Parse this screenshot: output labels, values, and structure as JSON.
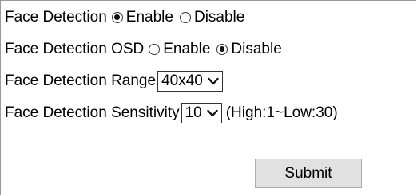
{
  "face_detection": {
    "label": "Face Detection",
    "options": [
      {
        "label": "Enable",
        "checked": true
      },
      {
        "label": "Disable",
        "checked": false
      }
    ]
  },
  "face_detection_osd": {
    "label": "Face Detection OSD",
    "options": [
      {
        "label": "Enable",
        "checked": false
      },
      {
        "label": "Disable",
        "checked": true
      }
    ]
  },
  "face_detection_range": {
    "label": "Face Detection Range",
    "selected": "40x40"
  },
  "face_detection_sensitivity": {
    "label": "Face Detection Sensitivity",
    "selected": "10",
    "hint": "(High:1~Low:30)"
  },
  "submit_label": "Submit",
  "icons": {
    "dropdown": "chevron-down-icon",
    "radio": "radio-icon"
  }
}
